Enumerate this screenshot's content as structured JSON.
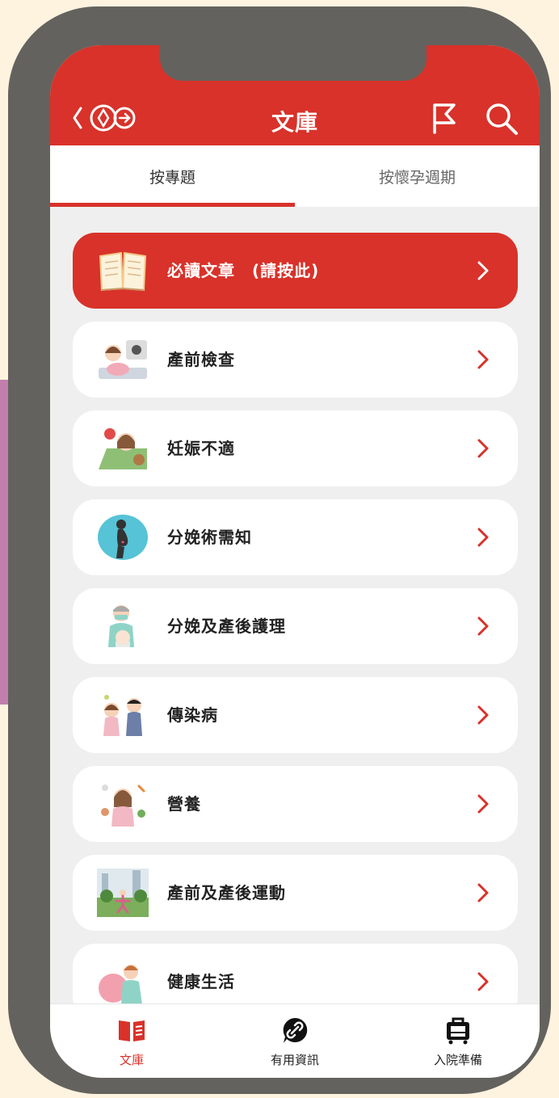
{
  "header": {
    "title": "文庫"
  },
  "tabs": [
    {
      "label": "按專題",
      "active": true
    },
    {
      "label": "按懷孕週期",
      "active": false
    }
  ],
  "featured": {
    "label": "必讀文章　(請按此)",
    "icon": "book-icon"
  },
  "topics": [
    {
      "label": "產前檢查",
      "icon": "ultrasound-illustration"
    },
    {
      "label": "妊娠不適",
      "icon": "discomfort-illustration"
    },
    {
      "label": "分娩術需知",
      "icon": "pregnant-silhouette-illustration"
    },
    {
      "label": "分娩及產後護理",
      "icon": "doctor-baby-illustration"
    },
    {
      "label": "傳染病",
      "icon": "sick-couple-illustration"
    },
    {
      "label": "營養",
      "icon": "nutrition-illustration"
    },
    {
      "label": "產前及產後運動",
      "icon": "exercise-park-illustration"
    },
    {
      "label": "健康生活",
      "icon": "healthy-life-illustration"
    }
  ],
  "bottom_nav": [
    {
      "label": "文庫",
      "icon": "book-icon",
      "active": true
    },
    {
      "label": "有用資訊",
      "icon": "link-icon",
      "active": false
    },
    {
      "label": "入院準備",
      "icon": "suitcase-icon",
      "active": false
    }
  ],
  "colors": {
    "accent": "#d8322a",
    "frame": "#64625e",
    "background": "#fdf3df",
    "side_strip": "#c27fae"
  }
}
